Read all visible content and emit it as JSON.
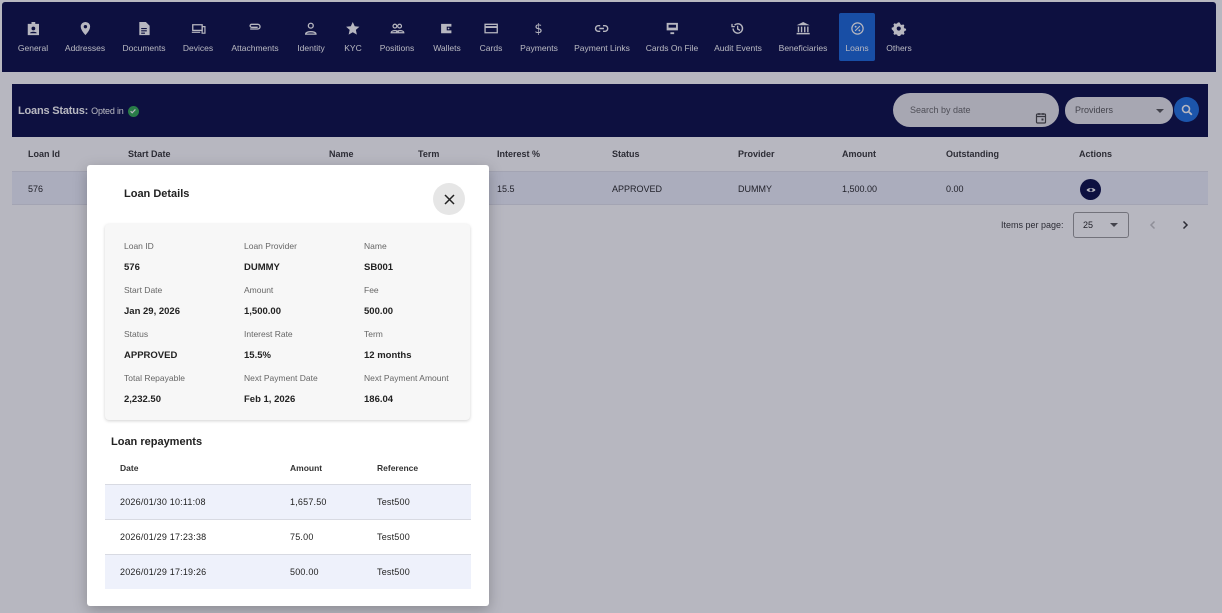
{
  "nav": {
    "items": [
      {
        "label": "General",
        "icon": "badge-icon"
      },
      {
        "label": "Addresses",
        "icon": "location-pin-icon"
      },
      {
        "label": "Documents",
        "icon": "document-icon"
      },
      {
        "label": "Devices",
        "icon": "devices-icon"
      },
      {
        "label": "Attachments",
        "icon": "paperclip-icon"
      },
      {
        "label": "Identity",
        "icon": "person-icon"
      },
      {
        "label": "KYC",
        "icon": "star-icon"
      },
      {
        "label": "Positions",
        "icon": "group-icon"
      },
      {
        "label": "Wallets",
        "icon": "wallet-icon"
      },
      {
        "label": "Cards",
        "icon": "credit-card-icon"
      },
      {
        "label": "Payments",
        "icon": "dollar-icon"
      },
      {
        "label": "Payment Links",
        "icon": "link-icon"
      },
      {
        "label": "Cards On File",
        "icon": "terminal-icon"
      },
      {
        "label": "Audit Events",
        "icon": "history-icon"
      },
      {
        "label": "Beneficiaries",
        "icon": "bank-icon"
      },
      {
        "label": "Loans",
        "icon": "loan-icon",
        "active": true
      },
      {
        "label": "Others",
        "icon": "gear-icon"
      }
    ]
  },
  "status": {
    "title": "Loans Status:",
    "value": "Opted in"
  },
  "filters": {
    "date_placeholder": "Search by date",
    "providers_label": "Providers"
  },
  "table": {
    "headers": {
      "loan_id": "Loan Id",
      "start_date": "Start Date",
      "name": "Name",
      "term": "Term",
      "interest": "Interest %",
      "status": "Status",
      "provider": "Provider",
      "amount": "Amount",
      "outstanding": "Outstanding",
      "actions": "Actions"
    },
    "row": {
      "loan_id": "576",
      "interest": "15.5",
      "status": "APPROVED",
      "provider": "DUMMY",
      "amount": "1,500.00",
      "outstanding": "0.00"
    }
  },
  "paginator": {
    "label": "Items per page:",
    "size": "25"
  },
  "modal": {
    "title": "Loan Details",
    "fields": {
      "loan_id": {
        "label": "Loan ID",
        "value": "576"
      },
      "provider": {
        "label": "Loan Provider",
        "value": "DUMMY"
      },
      "name": {
        "label": "Name",
        "value": "SB001"
      },
      "start_date": {
        "label": "Start Date",
        "value": "Jan 29, 2026"
      },
      "amount": {
        "label": "Amount",
        "value": "1,500.00"
      },
      "fee": {
        "label": "Fee",
        "value": "500.00"
      },
      "status": {
        "label": "Status",
        "value": "APPROVED"
      },
      "interest_rate": {
        "label": "Interest Rate",
        "value": "15.5%"
      },
      "term": {
        "label": "Term",
        "value": "12 months"
      },
      "total_repayable": {
        "label": "Total Repayable",
        "value": "2,232.50"
      },
      "next_payment_date": {
        "label": "Next Payment Date",
        "value": "Feb 1, 2026"
      },
      "next_payment_amount": {
        "label": "Next Payment Amount",
        "value": "186.04"
      }
    },
    "repayments": {
      "title": "Loan repayments",
      "headers": {
        "date": "Date",
        "amount": "Amount",
        "reference": "Reference"
      },
      "rows": [
        {
          "date": "2026/01/30 10:11:08",
          "amount": "1,657.50",
          "reference": "Test500"
        },
        {
          "date": "2026/01/29 17:23:38",
          "amount": "75.00",
          "reference": "Test500"
        },
        {
          "date": "2026/01/29 17:19:26",
          "amount": "500.00",
          "reference": "Test500"
        }
      ]
    }
  },
  "colors": {
    "nav_bg": "#050a43",
    "active_tab": "#1565d8",
    "row_highlight": "#eef1fb",
    "opted_in_badge": "#2fa84f"
  }
}
